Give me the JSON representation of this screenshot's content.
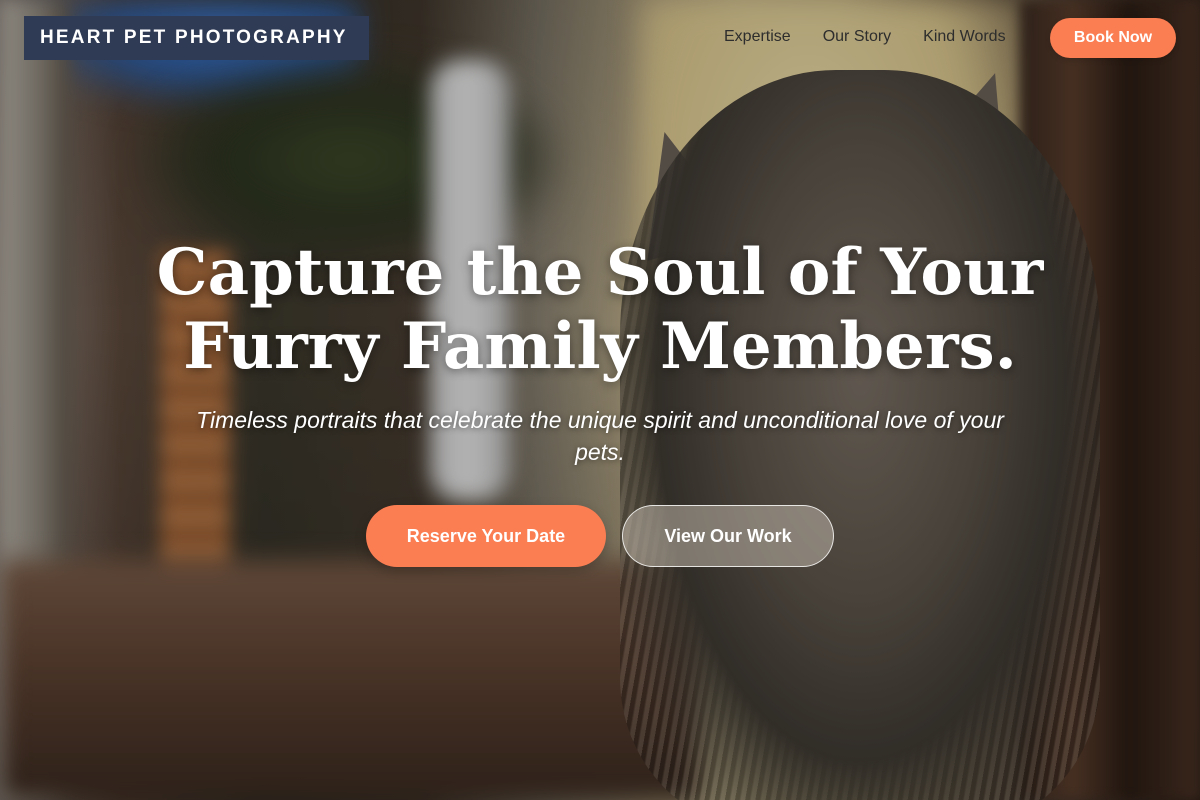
{
  "header": {
    "brand": "HEART PET PHOTOGRAPHY",
    "nav_links": [
      "Expertise",
      "Our Story",
      "Kind Words"
    ],
    "book_label": "Book Now"
  },
  "hero": {
    "title_line1": "Capture the Soul of Your",
    "title_line2": "Furry Family Members.",
    "subtitle": "Timeless portraits that celebrate the unique spirit and unconditional love of your pets.",
    "primary_cta": "Reserve Your Date",
    "secondary_cta": "View Our Work"
  },
  "colors": {
    "accent": "#fb7d52",
    "brand_bg": "#2f3b55",
    "nav_text": "#2d2d2d",
    "hero_text": "#ffffff"
  }
}
